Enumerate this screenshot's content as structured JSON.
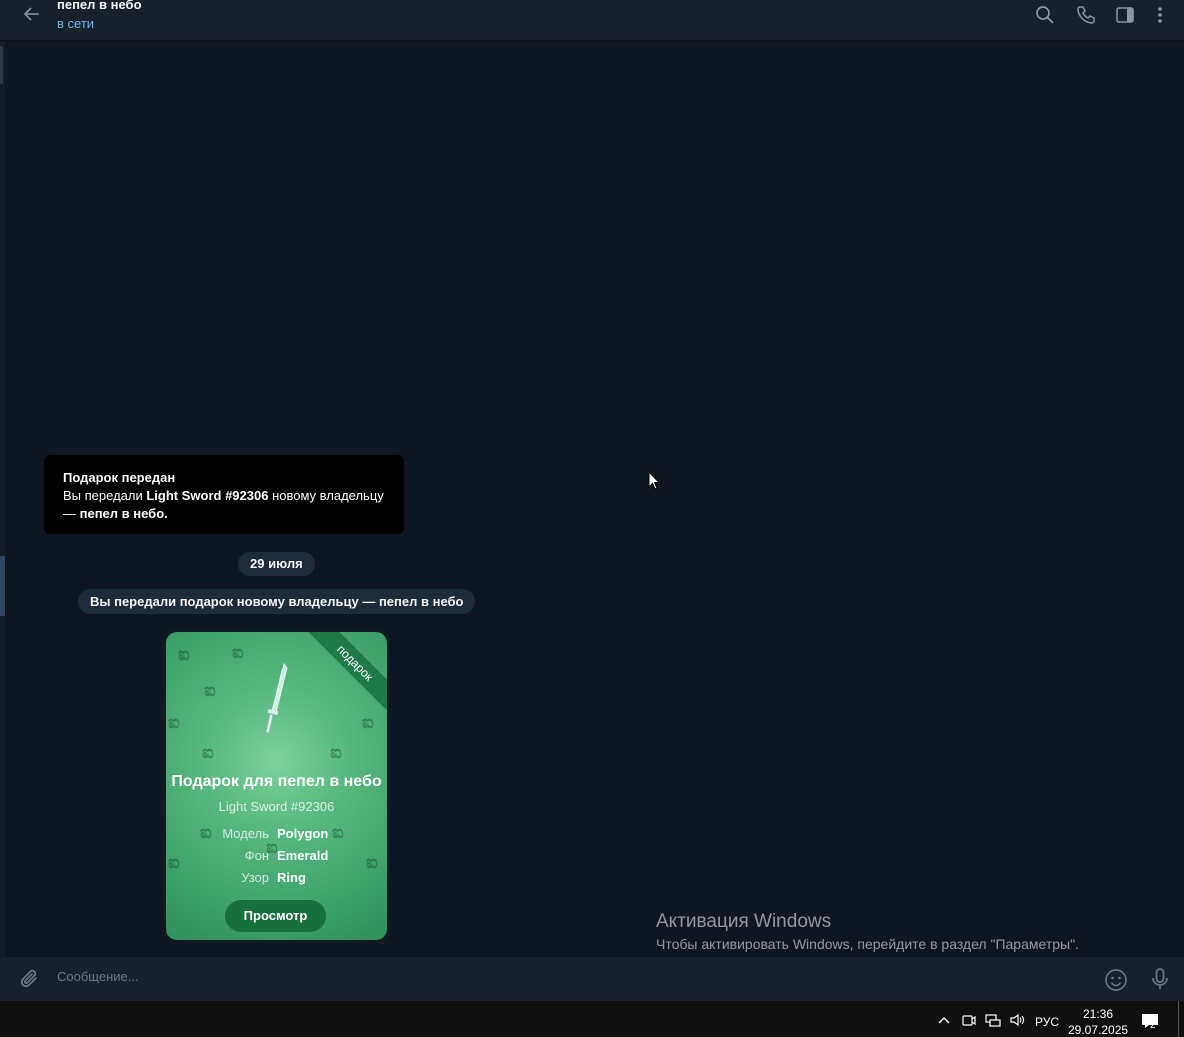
{
  "header": {
    "title": "пепел в небо",
    "status": "в сети",
    "icons": [
      "back-arrow-icon",
      "search-icon",
      "phone-icon",
      "sidebar-toggle-icon",
      "more-vertical-icon"
    ]
  },
  "notice": {
    "title": "Подарок передан",
    "line_prefix": "Вы передали ",
    "gift_name": "Light Sword #92306",
    "line_middle": " новому владельцу",
    "line_dash": "— ",
    "recipient": "пепел в небо."
  },
  "date_label": "29 июля",
  "service_message": "Вы передали подарок новому владельцу — пепел в небо",
  "gift": {
    "ribbon": "подарок",
    "title": "Подарок для пепел в небо",
    "subtitle": "Light Sword #92306",
    "attributes": [
      {
        "key": "Модель",
        "value": "Polygon"
      },
      {
        "key": "Фон",
        "value": "Emerald"
      },
      {
        "key": "Узор",
        "value": "Ring"
      }
    ],
    "button": "Просмотр",
    "bg_color": "#4fb279",
    "button_color": "#17703e"
  },
  "watermark": {
    "title": "Активация Windows",
    "text": "Чтобы активировать Windows, перейдите в раздел \"Параметры\"."
  },
  "composer": {
    "placeholder": "Сообщение..."
  },
  "taskbar": {
    "language": "РУС",
    "time": "21:36",
    "date": "29.07.2025",
    "notification_count": "2"
  },
  "colors": {
    "app_bg": "#0e1621",
    "header_bg": "#17212b",
    "accent": "#6ab3f3"
  }
}
